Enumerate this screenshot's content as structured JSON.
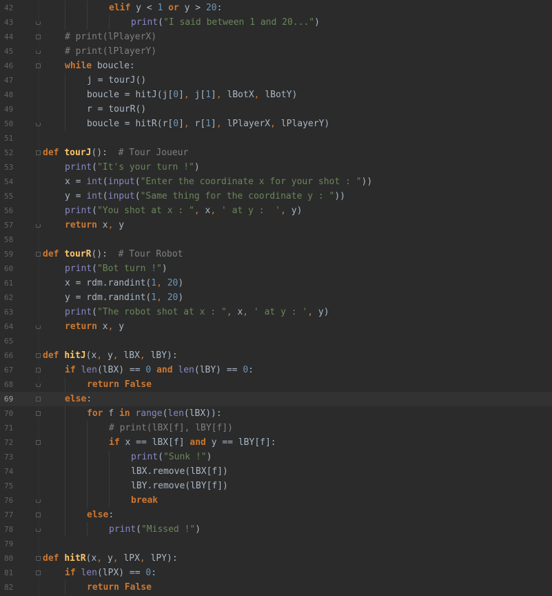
{
  "editor": {
    "language": "python",
    "current_line": 69,
    "lines": [
      {
        "n": "42",
        "indent": 3,
        "fold": "",
        "tokens": [
          [
            "kw",
            "elif "
          ],
          [
            "pl",
            "y "
          ],
          [
            "op",
            "< "
          ],
          [
            "num",
            "1 "
          ],
          [
            "kw",
            "or "
          ],
          [
            "pl",
            "y "
          ],
          [
            "op",
            "> "
          ],
          [
            "num",
            "20"
          ],
          [
            "pl",
            ":"
          ]
        ]
      },
      {
        "n": "43",
        "indent": 4,
        "fold": "end",
        "tokens": [
          [
            "bi",
            "print"
          ],
          [
            "pl",
            "("
          ],
          [
            "str",
            "\"I said between 1 and 20...\""
          ],
          [
            "pl",
            ")"
          ]
        ]
      },
      {
        "n": "44",
        "indent": 1,
        "fold": "open",
        "tokens": [
          [
            "cm",
            "# print(lPlayerX)"
          ]
        ]
      },
      {
        "n": "45",
        "indent": 1,
        "fold": "end",
        "tokens": [
          [
            "cm",
            "# print(lPlayerY)"
          ]
        ]
      },
      {
        "n": "46",
        "indent": 1,
        "fold": "open",
        "tokens": [
          [
            "kw",
            "while "
          ],
          [
            "pl",
            "boucle:"
          ]
        ]
      },
      {
        "n": "47",
        "indent": 2,
        "fold": "",
        "tokens": [
          [
            "pl",
            "j = tourJ()"
          ]
        ]
      },
      {
        "n": "48",
        "indent": 2,
        "fold": "",
        "tokens": [
          [
            "pl",
            "boucle = hitJ(j["
          ],
          [
            "num",
            "0"
          ],
          [
            "pl",
            "]"
          ],
          [
            "pu",
            ", "
          ],
          [
            "pl",
            "j["
          ],
          [
            "num",
            "1"
          ],
          [
            "pl",
            "]"
          ],
          [
            "pu",
            ", "
          ],
          [
            "pl",
            "lBotX"
          ],
          [
            "pu",
            ", "
          ],
          [
            "pl",
            "lBotY)"
          ]
        ]
      },
      {
        "n": "49",
        "indent": 2,
        "fold": "",
        "tokens": [
          [
            "pl",
            "r = tourR()"
          ]
        ]
      },
      {
        "n": "50",
        "indent": 2,
        "fold": "end",
        "tokens": [
          [
            "pl",
            "boucle = hitR(r["
          ],
          [
            "num",
            "0"
          ],
          [
            "pl",
            "]"
          ],
          [
            "pu",
            ", "
          ],
          [
            "pl",
            "r["
          ],
          [
            "num",
            "1"
          ],
          [
            "pl",
            "]"
          ],
          [
            "pu",
            ", "
          ],
          [
            "pl",
            "lPlayerX"
          ],
          [
            "pu",
            ", "
          ],
          [
            "pl",
            "lPlayerY)"
          ]
        ]
      },
      {
        "n": "51",
        "indent": 0,
        "fold": "",
        "tokens": []
      },
      {
        "n": "52",
        "indent": 0,
        "fold": "open",
        "tokens": [
          [
            "kw",
            "def "
          ],
          [
            "fn",
            "tourJ"
          ],
          [
            "pl",
            "():  "
          ],
          [
            "cm",
            "# Tour Joueur"
          ]
        ]
      },
      {
        "n": "53",
        "indent": 1,
        "fold": "",
        "tokens": [
          [
            "bi",
            "print"
          ],
          [
            "pl",
            "("
          ],
          [
            "str",
            "\"It's your turn !\""
          ],
          [
            "pl",
            ")"
          ]
        ]
      },
      {
        "n": "54",
        "indent": 1,
        "fold": "",
        "tokens": [
          [
            "pl",
            "x = "
          ],
          [
            "bi",
            "int"
          ],
          [
            "pl",
            "("
          ],
          [
            "bi",
            "input"
          ],
          [
            "pl",
            "("
          ],
          [
            "str",
            "\"Enter the coordinate x for your shot : \""
          ],
          [
            "pl",
            "))"
          ]
        ]
      },
      {
        "n": "55",
        "indent": 1,
        "fold": "",
        "tokens": [
          [
            "pl",
            "y = "
          ],
          [
            "bi",
            "int"
          ],
          [
            "pl",
            "("
          ],
          [
            "bi",
            "input"
          ],
          [
            "pl",
            "("
          ],
          [
            "str",
            "\"Same thing for the coordinate y : \""
          ],
          [
            "pl",
            "))"
          ]
        ]
      },
      {
        "n": "56",
        "indent": 1,
        "fold": "",
        "tokens": [
          [
            "bi",
            "print"
          ],
          [
            "pl",
            "("
          ],
          [
            "str",
            "\"You shot at x : \""
          ],
          [
            "pu",
            ", "
          ],
          [
            "pl",
            "x"
          ],
          [
            "pu",
            ", "
          ],
          [
            "str",
            "' at y :  '"
          ],
          [
            "pu",
            ", "
          ],
          [
            "pl",
            "y)"
          ]
        ]
      },
      {
        "n": "57",
        "indent": 1,
        "fold": "end",
        "tokens": [
          [
            "kw",
            "return "
          ],
          [
            "pl",
            "x"
          ],
          [
            "pu",
            ", "
          ],
          [
            "pl",
            "y"
          ]
        ]
      },
      {
        "n": "58",
        "indent": 0,
        "fold": "",
        "tokens": []
      },
      {
        "n": "59",
        "indent": 0,
        "fold": "open",
        "tokens": [
          [
            "kw",
            "def "
          ],
          [
            "fn",
            "tourR"
          ],
          [
            "pl",
            "():  "
          ],
          [
            "cm",
            "# Tour Robot"
          ]
        ]
      },
      {
        "n": "60",
        "indent": 1,
        "fold": "",
        "tokens": [
          [
            "bi",
            "print"
          ],
          [
            "pl",
            "("
          ],
          [
            "str",
            "\"Bot turn !\""
          ],
          [
            "pl",
            ")"
          ]
        ]
      },
      {
        "n": "61",
        "indent": 1,
        "fold": "",
        "tokens": [
          [
            "pl",
            "x = rdm.randint("
          ],
          [
            "num",
            "1"
          ],
          [
            "pu",
            ", "
          ],
          [
            "num",
            "20"
          ],
          [
            "pl",
            ")"
          ]
        ]
      },
      {
        "n": "62",
        "indent": 1,
        "fold": "",
        "tokens": [
          [
            "pl",
            "y = rdm.randint("
          ],
          [
            "num",
            "1"
          ],
          [
            "pu",
            ", "
          ],
          [
            "num",
            "20"
          ],
          [
            "pl",
            ")"
          ]
        ]
      },
      {
        "n": "63",
        "indent": 1,
        "fold": "",
        "tokens": [
          [
            "bi",
            "print"
          ],
          [
            "pl",
            "("
          ],
          [
            "str",
            "\"The robot shot at x : \""
          ],
          [
            "pu",
            ", "
          ],
          [
            "pl",
            "x"
          ],
          [
            "pu",
            ", "
          ],
          [
            "str",
            "' at y : '"
          ],
          [
            "pu",
            ", "
          ],
          [
            "pl",
            "y)"
          ]
        ]
      },
      {
        "n": "64",
        "indent": 1,
        "fold": "end",
        "tokens": [
          [
            "kw",
            "return "
          ],
          [
            "pl",
            "x"
          ],
          [
            "pu",
            ", "
          ],
          [
            "pl",
            "y"
          ]
        ]
      },
      {
        "n": "65",
        "indent": 0,
        "fold": "",
        "tokens": []
      },
      {
        "n": "66",
        "indent": 0,
        "fold": "open",
        "tokens": [
          [
            "kw",
            "def "
          ],
          [
            "fn",
            "hitJ"
          ],
          [
            "pl",
            "(x"
          ],
          [
            "pu",
            ", "
          ],
          [
            "pl",
            "y"
          ],
          [
            "pu",
            ", "
          ],
          [
            "pl",
            "lBX"
          ],
          [
            "pu",
            ", "
          ],
          [
            "pl",
            "lBY):"
          ]
        ]
      },
      {
        "n": "67",
        "indent": 1,
        "fold": "open",
        "tokens": [
          [
            "kw",
            "if "
          ],
          [
            "bi",
            "len"
          ],
          [
            "pl",
            "(lBX) == "
          ],
          [
            "num",
            "0 "
          ],
          [
            "kw",
            "and "
          ],
          [
            "bi",
            "len"
          ],
          [
            "pl",
            "(lBY) == "
          ],
          [
            "num",
            "0"
          ],
          [
            "pl",
            ":"
          ]
        ]
      },
      {
        "n": "68",
        "indent": 2,
        "fold": "end",
        "tokens": [
          [
            "kw",
            "return False"
          ]
        ]
      },
      {
        "n": "69",
        "indent": 1,
        "fold": "open",
        "tokens": [
          [
            "kw",
            "else"
          ],
          [
            "pl",
            ":"
          ]
        ]
      },
      {
        "n": "70",
        "indent": 2,
        "fold": "open",
        "tokens": [
          [
            "kw",
            "for "
          ],
          [
            "pl",
            "f "
          ],
          [
            "kw",
            "in "
          ],
          [
            "bi",
            "range"
          ],
          [
            "pl",
            "("
          ],
          [
            "bi",
            "len"
          ],
          [
            "pl",
            "(lBX)):"
          ]
        ]
      },
      {
        "n": "71",
        "indent": 3,
        "fold": "",
        "tokens": [
          [
            "cm",
            "# print(lBX[f], lBY[f])"
          ]
        ]
      },
      {
        "n": "72",
        "indent": 3,
        "fold": "open",
        "tokens": [
          [
            "kw",
            "if "
          ],
          [
            "pl",
            "x == lBX[f] "
          ],
          [
            "kw",
            "and "
          ],
          [
            "pl",
            "y == lBY[f]:"
          ]
        ]
      },
      {
        "n": "73",
        "indent": 4,
        "fold": "",
        "tokens": [
          [
            "bi",
            "print"
          ],
          [
            "pl",
            "("
          ],
          [
            "str",
            "\"Sunk !\""
          ],
          [
            "pl",
            ")"
          ]
        ]
      },
      {
        "n": "74",
        "indent": 4,
        "fold": "",
        "tokens": [
          [
            "pl",
            "lBX.remove(lBX[f])"
          ]
        ]
      },
      {
        "n": "75",
        "indent": 4,
        "fold": "",
        "tokens": [
          [
            "pl",
            "lBY.remove(lBY[f])"
          ]
        ]
      },
      {
        "n": "76",
        "indent": 4,
        "fold": "end",
        "tokens": [
          [
            "kw",
            "break"
          ]
        ]
      },
      {
        "n": "77",
        "indent": 2,
        "fold": "open",
        "tokens": [
          [
            "kw",
            "else"
          ],
          [
            "pl",
            ":"
          ]
        ]
      },
      {
        "n": "78",
        "indent": 3,
        "fold": "end",
        "tokens": [
          [
            "bi",
            "print"
          ],
          [
            "pl",
            "("
          ],
          [
            "str",
            "\"Missed !\""
          ],
          [
            "pl",
            ")"
          ]
        ]
      },
      {
        "n": "79",
        "indent": 0,
        "fold": "",
        "tokens": []
      },
      {
        "n": "80",
        "indent": 0,
        "fold": "open",
        "tokens": [
          [
            "kw",
            "def "
          ],
          [
            "fn",
            "hitR"
          ],
          [
            "pl",
            "(x"
          ],
          [
            "pu",
            ", "
          ],
          [
            "pl",
            "y"
          ],
          [
            "pu",
            ", "
          ],
          [
            "pl",
            "lPX"
          ],
          [
            "pu",
            ", "
          ],
          [
            "pl",
            "lPY):"
          ]
        ]
      },
      {
        "n": "81",
        "indent": 1,
        "fold": "open",
        "tokens": [
          [
            "kw",
            "if "
          ],
          [
            "bi",
            "len"
          ],
          [
            "pl",
            "(lPX) == "
          ],
          [
            "num",
            "0"
          ],
          [
            "pl",
            ":"
          ]
        ]
      },
      {
        "n": "82",
        "indent": 2,
        "fold": "",
        "tokens": [
          [
            "kw",
            "return False"
          ]
        ]
      }
    ]
  }
}
